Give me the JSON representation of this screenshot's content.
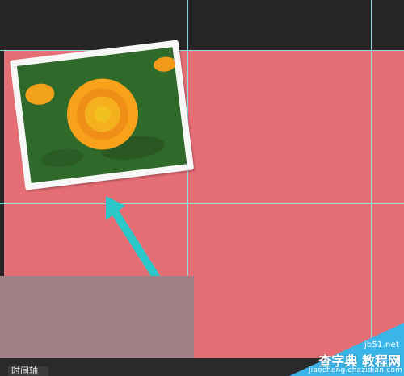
{
  "app": {
    "timeline_tab_label": "时间轴"
  },
  "colors": {
    "canvas": "#e56e75",
    "workspace": "#262626",
    "guides": "#8ee7ea",
    "photo_border": "#f7f7f7",
    "arrow": "#2cc7c9",
    "overlay_box": "#a17f86",
    "watermark_blue": "#3bb4e8"
  },
  "icons": {
    "arrow": "arrow-icon",
    "photo": "flower-photo"
  },
  "watermark": {
    "line1": "jb51.net",
    "line2": "查字典 教程网",
    "line3": "jiaocheng.chazidian.com"
  }
}
